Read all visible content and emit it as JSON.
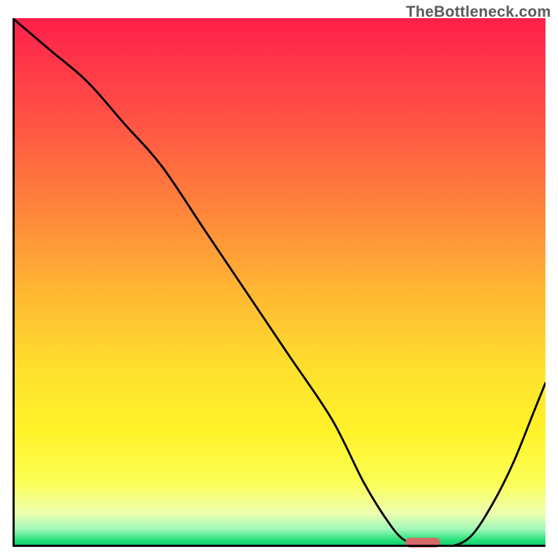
{
  "watermark": "TheBottleneck.com",
  "colors": {
    "curve": "#000000",
    "marker": "#d36a6a",
    "axis": "#000000"
  },
  "chart_data": {
    "type": "line",
    "title": "",
    "xlabel": "",
    "ylabel": "",
    "xlim": [
      0,
      100
    ],
    "ylim": [
      0,
      100
    ],
    "grid": false,
    "legend": false,
    "x": [
      0,
      7,
      14,
      21,
      28,
      36,
      44,
      52,
      60,
      66,
      71,
      74,
      78,
      82,
      86,
      90,
      94,
      98,
      100
    ],
    "values": [
      100,
      94,
      88,
      80,
      72,
      60,
      48,
      36,
      24,
      12,
      4,
      1,
      0,
      0,
      2,
      8,
      16,
      26,
      31
    ],
    "marker": {
      "x": 77,
      "y": 0,
      "shape": "pill"
    },
    "description": "V-shaped bottleneck curve with minimum near x≈77, overlaid on a vertical red→yellow→green heat gradient."
  }
}
